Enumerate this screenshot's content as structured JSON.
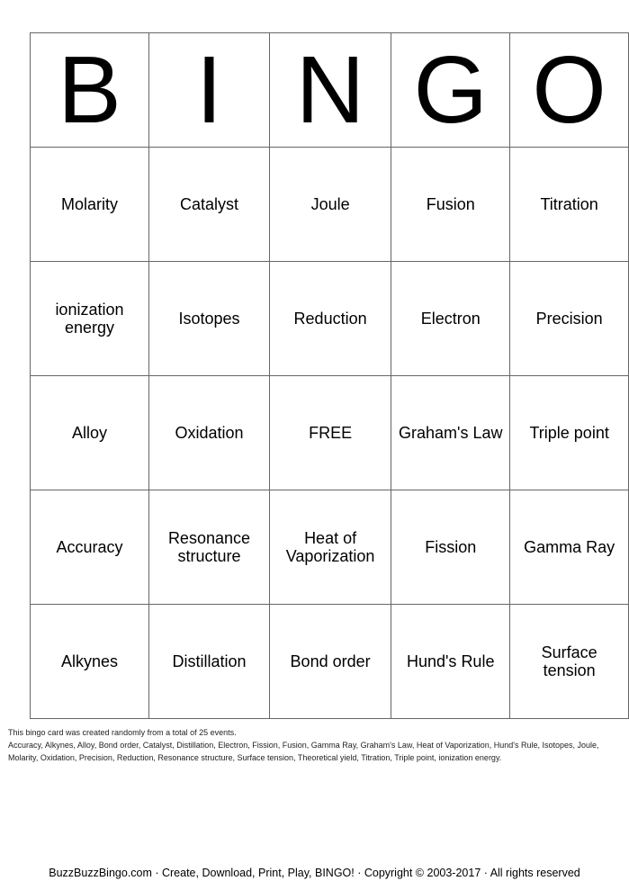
{
  "header": [
    "B",
    "I",
    "N",
    "G",
    "O"
  ],
  "rows": [
    [
      "Molarity",
      "Catalyst",
      "Joule",
      "Fusion",
      "Titration"
    ],
    [
      "ionization energy",
      "Isotopes",
      "Reduction",
      "Electron",
      "Precision"
    ],
    [
      "Alloy",
      "Oxidation",
      "FREE",
      "Graham's Law",
      "Triple point"
    ],
    [
      "Accuracy",
      "Resonance structure",
      "Heat of Vaporization",
      "Fission",
      "Gamma Ray"
    ],
    [
      "Alkynes",
      "Distillation",
      "Bond order",
      "Hund's Rule",
      "Surface tension"
    ]
  ],
  "info": {
    "line1": "This bingo card was created randomly from a total of 25 events.",
    "line2": "Accuracy, Alkynes, Alloy, Bond order, Catalyst, Distillation, Electron, Fission, Fusion, Gamma Ray, Graham's Law, Heat of Vaporization, Hund's Rule, Isotopes, Joule, Molarity, Oxidation, Precision, Reduction, Resonance structure, Surface tension, Theoretical yield, Titration, Triple point, ionization energy."
  },
  "footer": "BuzzBuzzBingo.com · Create, Download, Print, Play, BINGO! · Copyright © 2003-2017 · All rights reserved"
}
